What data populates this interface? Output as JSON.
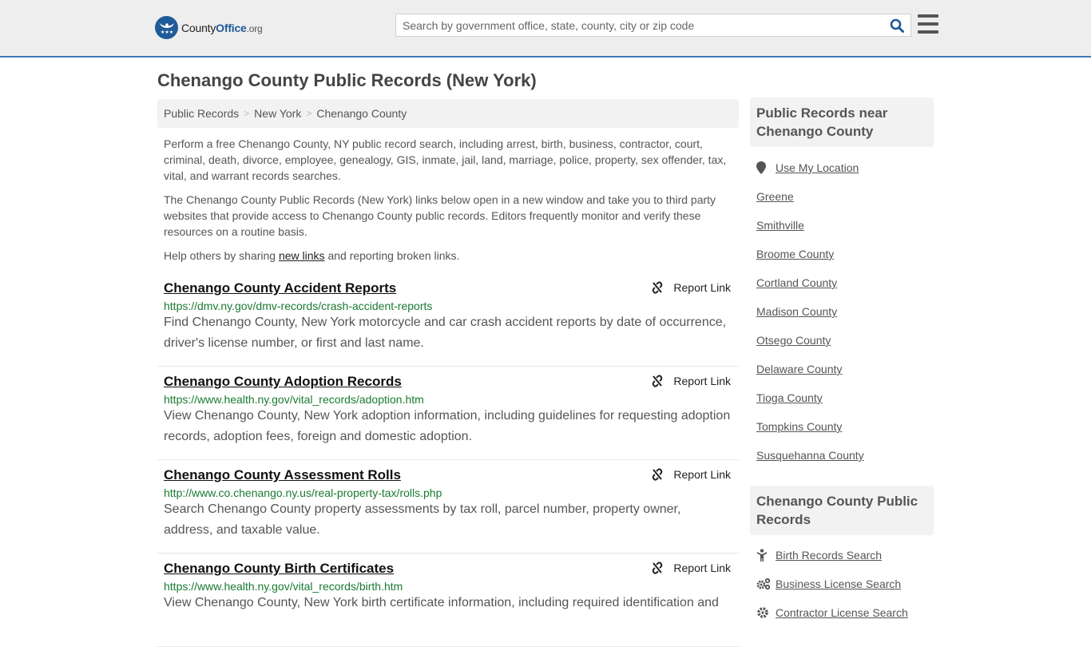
{
  "header": {
    "logo": {
      "county": "County",
      "office": "Office",
      "org": ".org"
    },
    "search_placeholder": "Search by government office, state, county, city or zip code",
    "search_value": "",
    "colors": {
      "brand": "#1f5b98",
      "accent_border": "#3b7ab5",
      "url_green": "#1a7a32"
    }
  },
  "page": {
    "title": "Chenango County Public Records (New York)",
    "breadcrumb": [
      "Public Records",
      "New York",
      "Chenango County"
    ],
    "intro": {
      "p1": "Perform a free Chenango County, NY public record search, including arrest, birth, business, contractor, court, criminal, death, divorce, employee, genealogy, GIS, inmate, jail, land, marriage, police, property, sex offender, tax, vital, and warrant records searches.",
      "p2": "The Chenango County Public Records (New York) links below open in a new window and take you to third party websites that provide access to Chenango County public records. Editors frequently monitor and verify these resources on a routine basis.",
      "p3_before": "Help others by sharing ",
      "p3_link": "new links",
      "p3_after": " and reporting broken links."
    },
    "report_label": "Report Link",
    "records": [
      {
        "title": "Chenango County Accident Reports",
        "url": "https://dmv.ny.gov/dmv-records/crash-accident-reports",
        "description": "Find Chenango County, New York motorcycle and car crash accident reports by date of occurrence, driver's license number, or first and last name."
      },
      {
        "title": "Chenango County Adoption Records",
        "url": "https://www.health.ny.gov/vital_records/adoption.htm",
        "description": "View Chenango County, New York adoption information, including guidelines for requesting adoption records, adoption fees, foreign and domestic adoption."
      },
      {
        "title": "Chenango County Assessment Rolls",
        "url": "http://www.co.chenango.ny.us/real-property-tax/rolls.php",
        "description": "Search Chenango County property assessments by tax roll, parcel number, property owner, address, and taxable value."
      },
      {
        "title": "Chenango County Birth Certificates",
        "url": "https://www.health.ny.gov/vital_records/birth.htm",
        "description": "View Chenango County, New York birth certificate information, including required identification and"
      }
    ]
  },
  "sidebar": {
    "near_heading": "Public Records near Chenango County",
    "use_location": "Use My Location",
    "near_items": [
      "Greene",
      "Smithville",
      "Broome County",
      "Cortland County",
      "Madison County",
      "Otsego County",
      "Delaware County",
      "Tioga County",
      "Tompkins County",
      "Susquehanna County"
    ],
    "records_heading": "Chenango County Public Records",
    "record_links": [
      {
        "label": "Birth Records Search",
        "icon": "child-icon"
      },
      {
        "label": "Business License Search",
        "icon": "gears-icon"
      },
      {
        "label": "Contractor License Search",
        "icon": "gear-icon"
      }
    ]
  }
}
